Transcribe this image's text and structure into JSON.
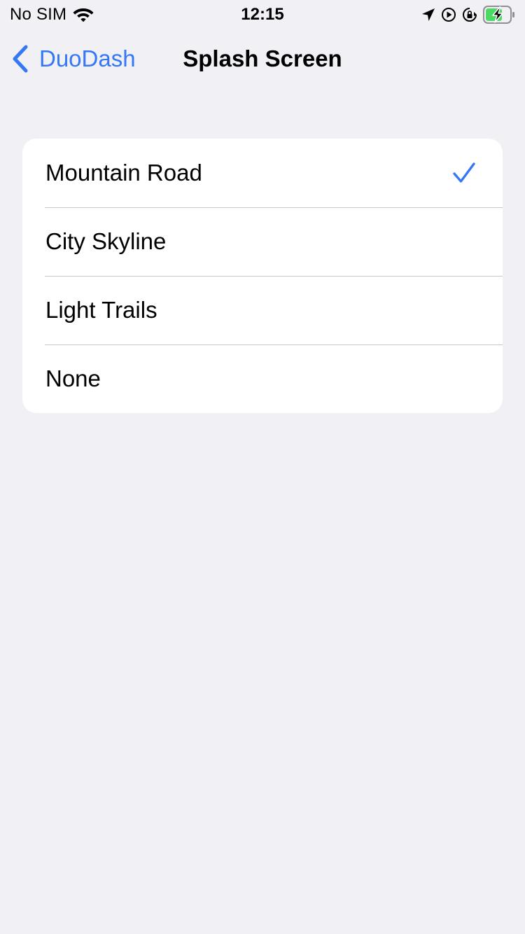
{
  "status_bar": {
    "carrier": "No SIM",
    "time": "12:15",
    "icons": [
      "wifi-icon",
      "location-arrow-icon",
      "play-circle-icon",
      "rotation-lock-icon",
      "battery-charging-icon"
    ]
  },
  "nav": {
    "back_label": "DuoDash",
    "title": "Splash Screen",
    "back_icon": "chevron-left-icon"
  },
  "options": [
    {
      "label": "Mountain Road",
      "selected": true
    },
    {
      "label": "City Skyline",
      "selected": false
    },
    {
      "label": "Light Trails",
      "selected": false
    },
    {
      "label": "None",
      "selected": false
    }
  ],
  "colors": {
    "accent": "#3478F6",
    "background": "#F0F0F5",
    "card": "#FFFFFF",
    "separator": "#C8C7CC",
    "battery_fill": "#4CD964"
  }
}
